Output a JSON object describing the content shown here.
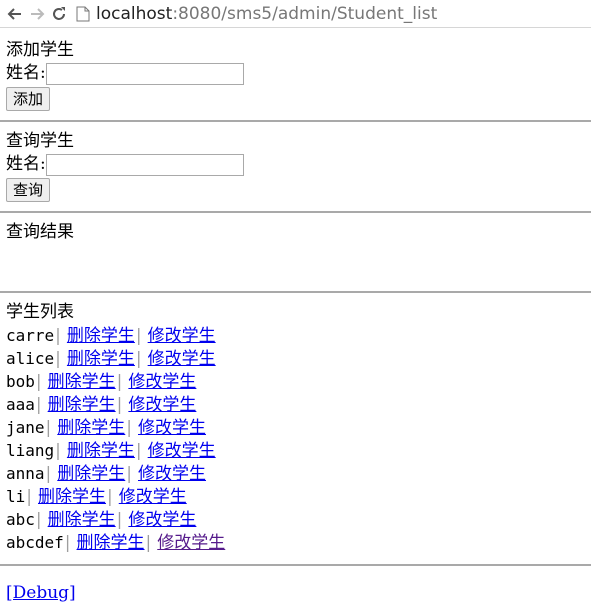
{
  "browser": {
    "url_host": "localhost",
    "url_path": ":8080/sms5/admin/Student_list"
  },
  "add": {
    "title": "添加学生",
    "name_label": "姓名:",
    "name_value": "",
    "button": "添加"
  },
  "query": {
    "title": "查询学生",
    "name_label": "姓名:",
    "name_value": "",
    "button": "查询"
  },
  "result": {
    "title": "查询结果"
  },
  "list": {
    "title": "学生列表",
    "separator": "|",
    "delete_label": "删除学生",
    "edit_label": "修改学生",
    "students": [
      "carre",
      "alice",
      "bob",
      "aaa",
      "jane",
      "liang",
      "anna",
      "li",
      "abc",
      "abcdef"
    ]
  },
  "footer": {
    "debug": "[Debug]"
  }
}
